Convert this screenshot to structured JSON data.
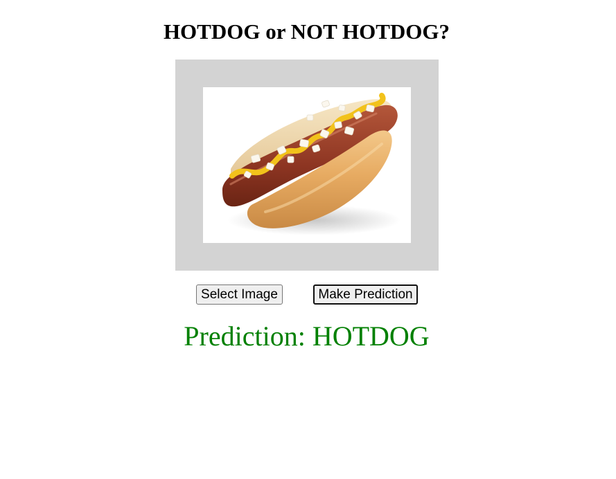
{
  "page": {
    "title": "HOTDOG or NOT HOTDOG?"
  },
  "image": {
    "icon": "hotdog-photo"
  },
  "buttons": {
    "select_label": "Select Image",
    "predict_label": "Make Prediction"
  },
  "result": {
    "label": "Prediction: HOTDOG",
    "color": "#008000"
  },
  "colors": {
    "frame_background": "#d3d3d3",
    "page_background": "#ffffff"
  }
}
